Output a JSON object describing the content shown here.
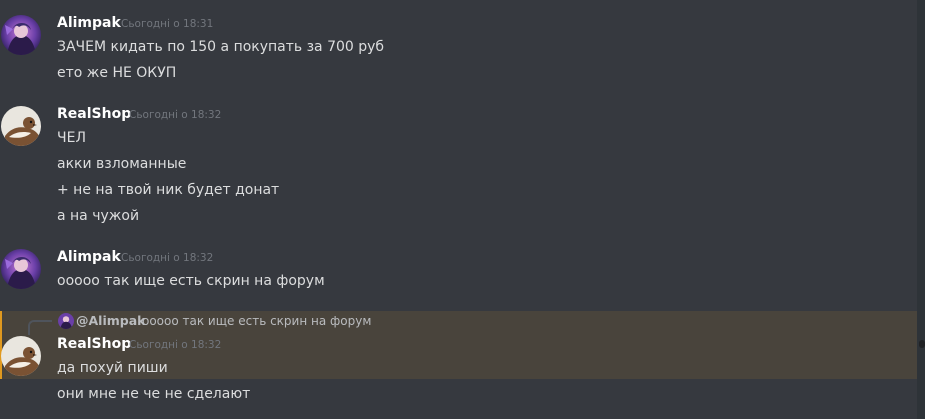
{
  "messages": [
    {
      "author": "Alimpak",
      "timestamp": "Сьогодні о 18:31",
      "lines": [
        "ЗАЧЕМ кидать по 150 а покупать за 700 руб",
        "ето же НЕ ОКУП"
      ]
    },
    {
      "author": "RealShop",
      "timestamp": "Сьогодні о 18:32",
      "lines": [
        "ЧЕЛ",
        "акки взломанные",
        "+ не на твой ник будет донат",
        "а на чужой"
      ]
    },
    {
      "author": "Alimpak",
      "timestamp": "Сьогодні о 18:32",
      "lines": [
        "ооооо так ище есть скрин на форум"
      ]
    },
    {
      "author": "RealShop",
      "timestamp": "Сьогодні о 18:32",
      "reply": {
        "author": "@Alimpak",
        "text": "ооооо так ище есть скрин на форум"
      },
      "lines": [
        "да похуй пиши",
        "они мне не че не сделают"
      ]
    }
  ],
  "colors": {
    "background": "#36393f",
    "highlight": "#49443c",
    "author": "#ffffff",
    "timestamp": "#72767d",
    "text": "#dcddde"
  },
  "icons": {
    "alimpak_avatar": "anime-avatar-icon",
    "realshop_avatar": "weasel-avatar-icon"
  }
}
